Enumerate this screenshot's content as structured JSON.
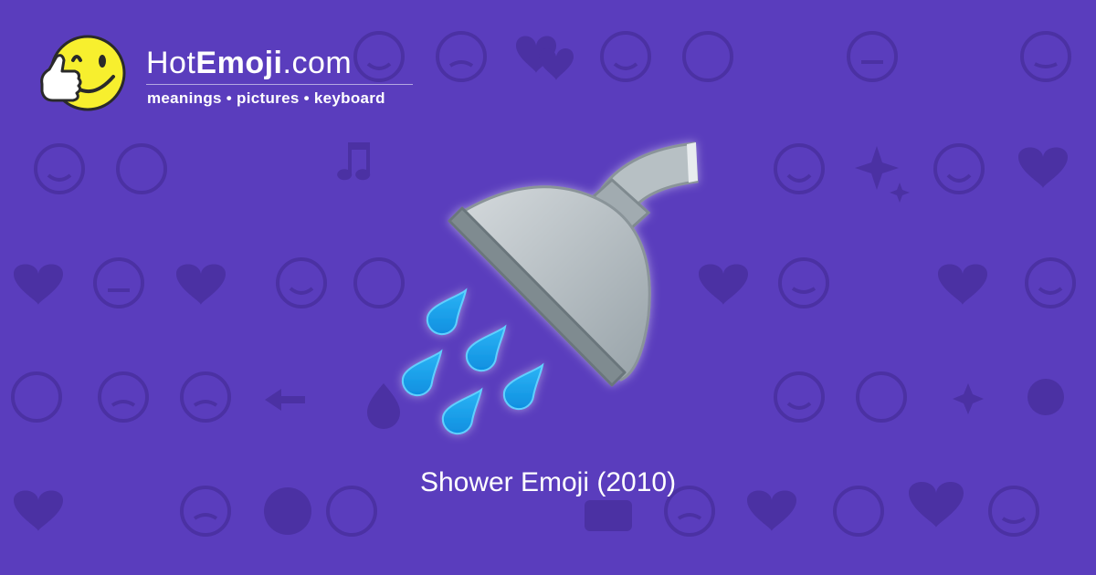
{
  "colors": {
    "background": "#5a3dbd",
    "pattern": "#4b31a3",
    "logo_face": "#f7ef2e",
    "water": "#1aa7f0",
    "metal": "#a9b3b8"
  },
  "logo": {
    "name_prefix": "Hot",
    "name_bold": "Emoji",
    "name_suffix": ".com",
    "tagline": "meanings • pictures • keyboard",
    "icon": "winking-thumbs-up-face-icon"
  },
  "main_icon": "shower-icon",
  "caption": "Shower Emoji (2010)"
}
